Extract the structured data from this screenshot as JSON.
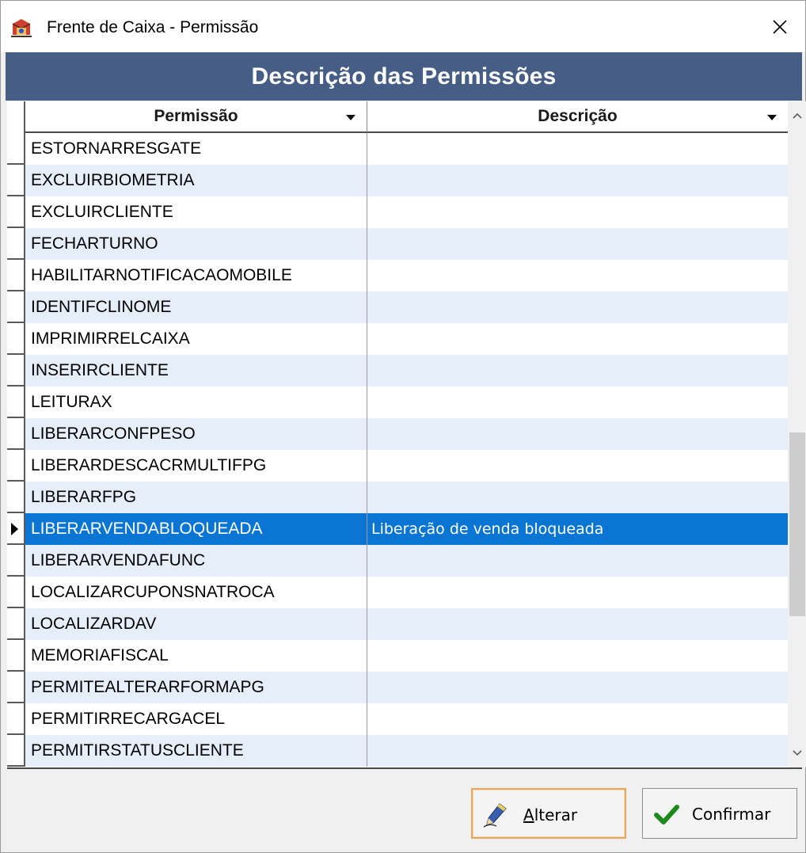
{
  "window": {
    "title": "Frente de Caixa - Permissão",
    "close_glyph": "✕"
  },
  "header": {
    "title": "Descrição das Permissões"
  },
  "grid": {
    "columns": [
      {
        "label": "Permissão"
      },
      {
        "label": "Descrição"
      }
    ],
    "rows": [
      {
        "permissao": "ESTORNARRESGATE",
        "descricao": ""
      },
      {
        "permissao": "EXCLUIRBIOMETRIA",
        "descricao": ""
      },
      {
        "permissao": "EXCLUIRCLIENTE",
        "descricao": ""
      },
      {
        "permissao": "FECHARTURNO",
        "descricao": ""
      },
      {
        "permissao": "HABILITARNOTIFICACAOMOBILE",
        "descricao": ""
      },
      {
        "permissao": "IDENTIFCLINOME",
        "descricao": ""
      },
      {
        "permissao": "IMPRIMIRRELCAIXA",
        "descricao": ""
      },
      {
        "permissao": "INSERIRCLIENTE",
        "descricao": ""
      },
      {
        "permissao": "LEITURAX",
        "descricao": ""
      },
      {
        "permissao": "LIBERARCONFPESO",
        "descricao": ""
      },
      {
        "permissao": "LIBERARDESCACRMULTIFPG",
        "descricao": ""
      },
      {
        "permissao": "LIBERARFPG",
        "descricao": ""
      },
      {
        "permissao": "LIBERARVENDABLOQUEADA",
        "descricao": "Liberação de venda bloqueada"
      },
      {
        "permissao": "LIBERARVENDAFUNC",
        "descricao": ""
      },
      {
        "permissao": "LOCALIZARCUPONSNATROCA",
        "descricao": ""
      },
      {
        "permissao": "LOCALIZARDAV",
        "descricao": ""
      },
      {
        "permissao": "MEMORIAFISCAL",
        "descricao": ""
      },
      {
        "permissao": "PERMITEALTERARFORMAPG",
        "descricao": ""
      },
      {
        "permissao": "PERMITIRRECARGACEL",
        "descricao": ""
      },
      {
        "permissao": "PERMITIRSTATUSCLIENTE",
        "descricao": ""
      }
    ],
    "selected_index": 12
  },
  "buttons": {
    "alterar": "Alterar",
    "confirmar": "Confirmar"
  },
  "colors": {
    "header_band": "#465e86",
    "selection": "#0a75d2",
    "alt_row": "#e6eef9",
    "confirm_check": "#1e8a1e"
  }
}
